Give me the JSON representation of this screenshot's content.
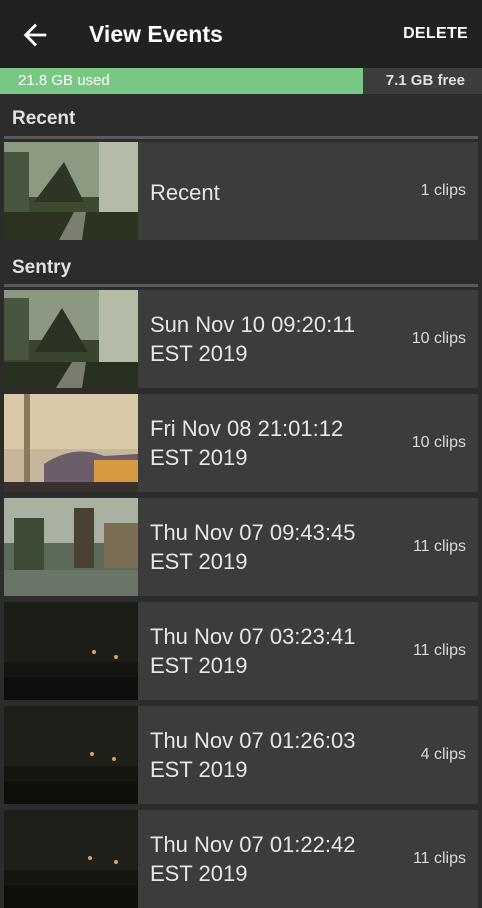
{
  "appbar": {
    "title": "View Events",
    "delete_label": "DELETE"
  },
  "storage": {
    "used_label": "21.8 GB used",
    "free_label": "7.1 GB free",
    "used_fraction": 0.754
  },
  "sections": {
    "recent": {
      "header": "Recent",
      "items": [
        {
          "label": "Recent",
          "clips": "1 clips"
        }
      ]
    },
    "sentry": {
      "header": "Sentry",
      "items": [
        {
          "line1": "Sun Nov 10 09:20:11",
          "line2": "EST 2019",
          "clips": "10 clips"
        },
        {
          "line1": "Fri Nov 08 21:01:12",
          "line2": "EST 2019",
          "clips": "10 clips"
        },
        {
          "line1": "Thu Nov 07 09:43:45",
          "line2": "EST 2019",
          "clips": "11 clips"
        },
        {
          "line1": "Thu Nov 07 03:23:41",
          "line2": "EST 2019",
          "clips": "11 clips"
        },
        {
          "line1": "Thu Nov 07 01:26:03",
          "line2": "EST 2019",
          "clips": "4 clips"
        },
        {
          "line1": "Thu Nov 07 01:22:42",
          "line2": "EST 2019",
          "clips": "11 clips"
        }
      ]
    }
  },
  "icons": {
    "back": "arrow-left-icon"
  }
}
